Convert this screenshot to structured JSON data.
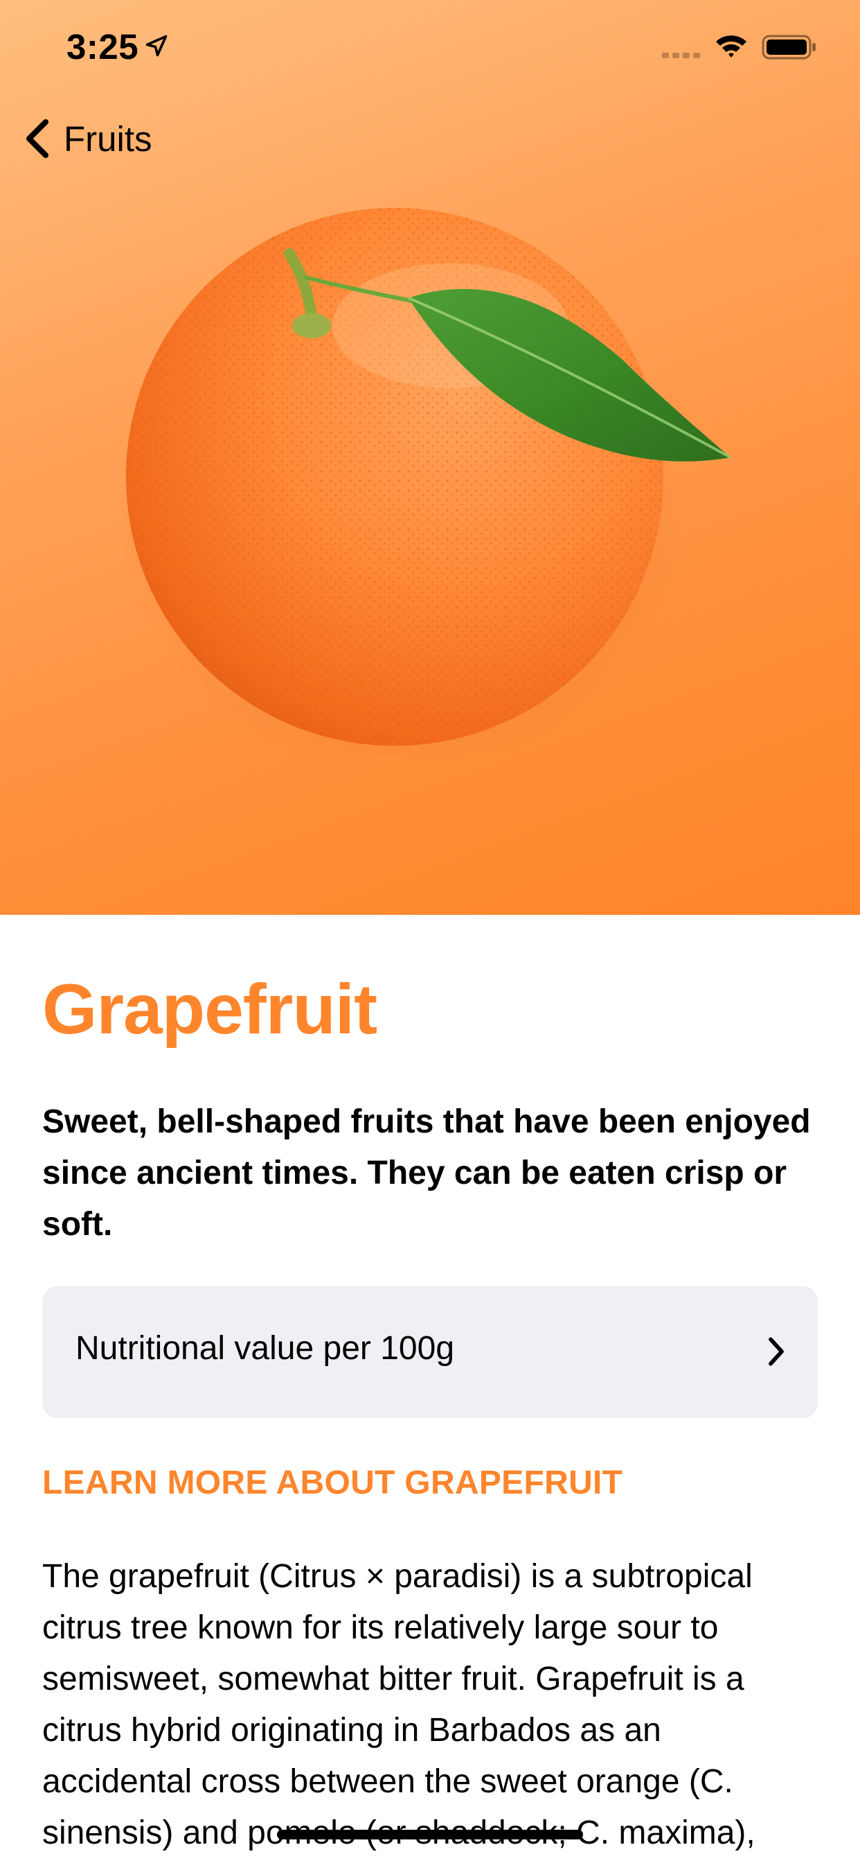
{
  "status_bar": {
    "time": "3:25",
    "icons": [
      "location-arrow-icon",
      "cellular-signal-icon",
      "wifi-icon",
      "battery-icon"
    ]
  },
  "nav": {
    "back_label": "Fruits",
    "back_icon": "chevron-left-icon"
  },
  "hero": {
    "image": "grapefruit-with-leaf",
    "gradient_colors": [
      "#ffbe7f",
      "#ff8428"
    ]
  },
  "fruit": {
    "title": "Grapefruit",
    "subtitle": "Sweet, bell-shaped fruits that have been enjoyed since ancient times. They can be eaten crisp or soft.",
    "nutrition_label": "Nutritional value per 100g",
    "nutrition_icon": "chevron-right-icon",
    "learn_more": "LEARN MORE ABOUT GRAPEFRUIT",
    "description": "The grapefruit (Citrus × paradisi) is a subtropical citrus tree known for its relatively large sour to semisweet, somewhat bitter fruit. Grapefruit is a citrus hybrid originating in Barbados as an accidental cross between the sweet orange (C. sinensis) and pomelo (or shaddock; C. maxima),"
  },
  "colors": {
    "accent": "#ff852c",
    "row_background": "#efeff4"
  }
}
